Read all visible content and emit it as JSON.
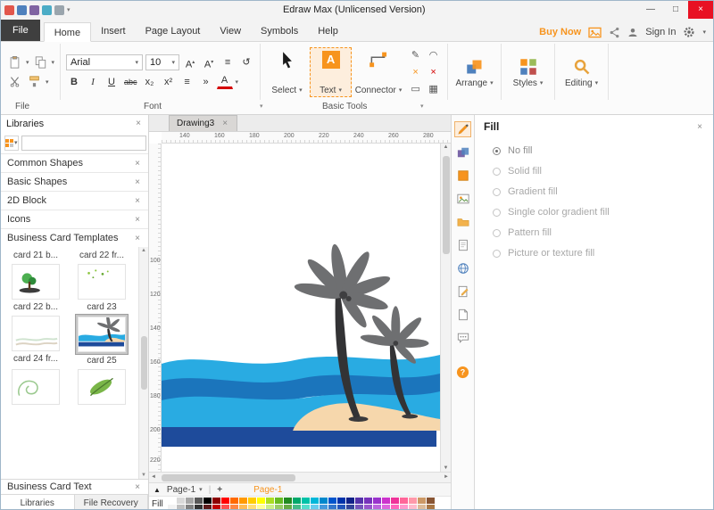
{
  "window": {
    "title": "Edraw Max (Unlicensed Version)"
  },
  "icons": {
    "close": "×",
    "dropdown": "▾",
    "up": "▴",
    "collapse": "▲",
    "scroll_up": "▲",
    "scroll_down": "▼",
    "scroll_left": "◄",
    "scroll_right": "►",
    "sep": "|",
    "minimize": "—",
    "maximize": "□",
    "pen": "✎",
    "arc": "◠",
    "line": "╱",
    "cross": "×",
    "rect": "▭",
    "grid": "▦",
    "bullets": "≡",
    "indent": "»",
    "rotate": "↺"
  },
  "menubar": {
    "file": "File",
    "tabs": [
      "Home",
      "Insert",
      "Page Layout",
      "View",
      "Symbols",
      "Help"
    ],
    "buy_now": "Buy Now",
    "sign_in": "Sign In"
  },
  "ribbon": {
    "font_name": "Arial",
    "font_size": "10",
    "bold": "B",
    "italic": "I",
    "underline": "U",
    "strike": "abc",
    "subscript": "x₂",
    "superscript": "x²",
    "grow": "A",
    "shrink": "A",
    "font_color": "A",
    "select": "Select",
    "text": "Text",
    "text_glyph": "A",
    "connector": "Connector",
    "arrange": "Arrange",
    "styles": "Styles",
    "editing": "Editing",
    "labels": [
      "File",
      "Font",
      "Basic Tools"
    ]
  },
  "sidebar": {
    "title": "Libraries",
    "library_items": [
      "Common Shapes",
      "Basic Shapes",
      "2D Block",
      "Icons",
      "Business Card Templates"
    ],
    "card_labels": [
      "card 21 b...",
      "card 22 fr...",
      "card 22 b...",
      "card 23",
      "card 24 fr...",
      "card 25"
    ],
    "selected_card": "card 25",
    "footer_item": "Business Card Text",
    "bottom_tabs": [
      "Libraries",
      "File Recovery"
    ]
  },
  "canvas": {
    "tab": "Drawing3",
    "h_ruler": [
      "140",
      "160",
      "180",
      "200",
      "220",
      "240",
      "260",
      "280"
    ],
    "v_ruler": [
      "100",
      "120",
      "140",
      "160",
      "180",
      "200",
      "220"
    ]
  },
  "fill_panel": {
    "title": "Fill",
    "options": [
      "No fill",
      "Solid fill",
      "Gradient fill",
      "Single color gradient fill",
      "Pattern fill",
      "Picture or texture fill"
    ],
    "selected_index": 0
  },
  "pagebar": {
    "page_tab": "Page-1",
    "add": "+",
    "current_page": "Page-1"
  },
  "palette": {
    "label": "Fill",
    "rows": [
      [
        "#ffffff",
        "#d9d9d9",
        "#a6a6a6",
        "#595959",
        "#000000",
        "#8b0000",
        "#ff0000",
        "#ff6a00",
        "#ff9900",
        "#ffcc00",
        "#ffff00",
        "#aadd22",
        "#66bb22",
        "#228b22",
        "#00a86b",
        "#00c2a8",
        "#00b7d9",
        "#0088cc",
        "#0055cc",
        "#0033aa",
        "#112288",
        "#5533aa",
        "#7733bb",
        "#9933cc",
        "#cc33cc",
        "#ee3399",
        "#ff6699",
        "#ff99aa",
        "#cc9966",
        "#885533"
      ],
      [
        "#f2f2f2",
        "#bfbfbf",
        "#808080",
        "#333333",
        "#5c1a1a",
        "#c00000",
        "#ff5050",
        "#ff8844",
        "#ffbb55",
        "#ffdd77",
        "#ffff99",
        "#ccee88",
        "#99cc66",
        "#66aa44",
        "#44bb88",
        "#55ddcc",
        "#66ccee",
        "#4499dd",
        "#3377cc",
        "#2255bb",
        "#334499",
        "#7755bb",
        "#9955cc",
        "#bb66dd",
        "#dd66dd",
        "#ff66bb",
        "#ff99cc",
        "#ffbbcc",
        "#ddbb99",
        "#aa7744"
      ]
    ]
  },
  "colors": {
    "accent": "#f7941e"
  }
}
